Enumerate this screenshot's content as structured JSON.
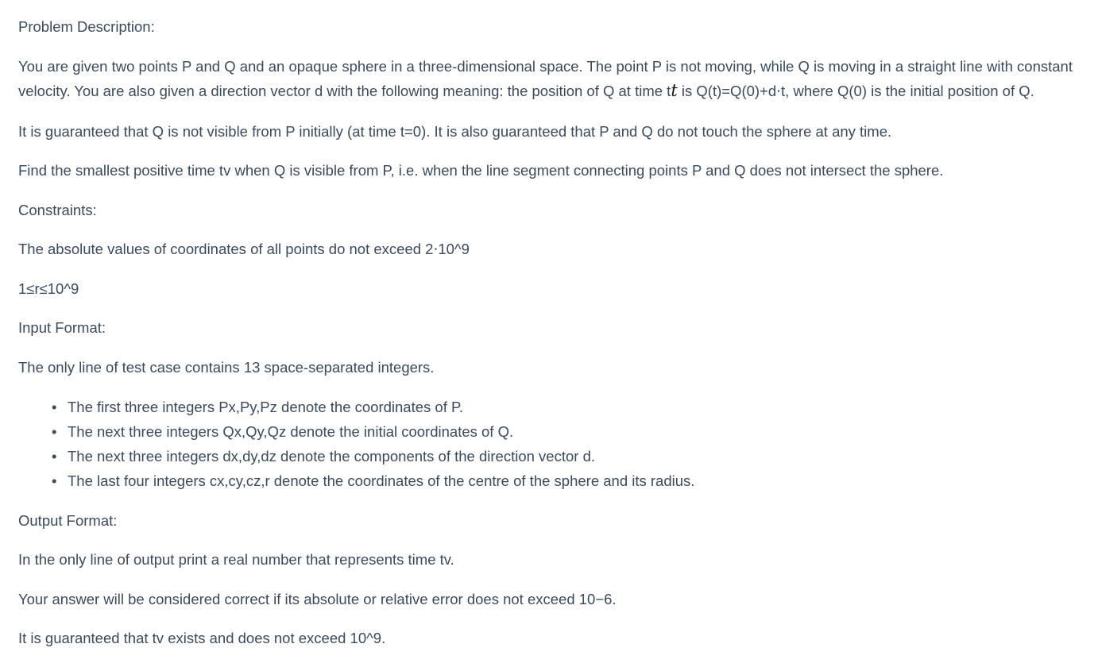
{
  "problem": {
    "heading": "Problem Description:",
    "p1_part1": "You are given two points P and Q and an opaque sphere in a three-dimensional space. The point P is not moving, while Q is moving in a straight line with constant velocity. You are also given a direction vector d with the following meaning: the position of Q at time t",
    "p1_t_symbol": "t",
    "p1_part2": " is Q(t)=Q(0)+d⋅t, where Q(0) is the initial position of Q.",
    "p2": "It is guaranteed that Q is not visible from P initially (at time t=0). It is also guaranteed that P and Q do not touch the sphere at any time.",
    "p3": "Find the smallest positive time tv when Q is visible from P, i.e. when the line segment connecting points P and Q does not intersect the sphere."
  },
  "constraints": {
    "heading": "Constraints:",
    "line1": "The absolute values of coordinates of all points do not exceed 2⋅10^9",
    "line2": "1≤r≤10^9"
  },
  "input": {
    "heading": "Input Format:",
    "description": "The only line of test case contains 13 space-separated integers.",
    "items": [
      "The first three integers Px,Py,Pz denote the coordinates of P.",
      "The next three integers Qx,Qy,Qz denote the initial coordinates of Q.",
      "The next three integers dx,dy,dz denote the components of the direction vector d.",
      "The last four integers cx,cy,cz,r denote the coordinates of the centre of the sphere and its radius."
    ]
  },
  "output": {
    "heading": "Output Format:",
    "description": "In the only line of output print a real number that represents time tv.",
    "error_note": "Your answer will be considered correct if its absolute or relative error does not exceed 10−6.",
    "guarantee": "It is guaranteed that tv exists and does not exceed 10^9."
  }
}
